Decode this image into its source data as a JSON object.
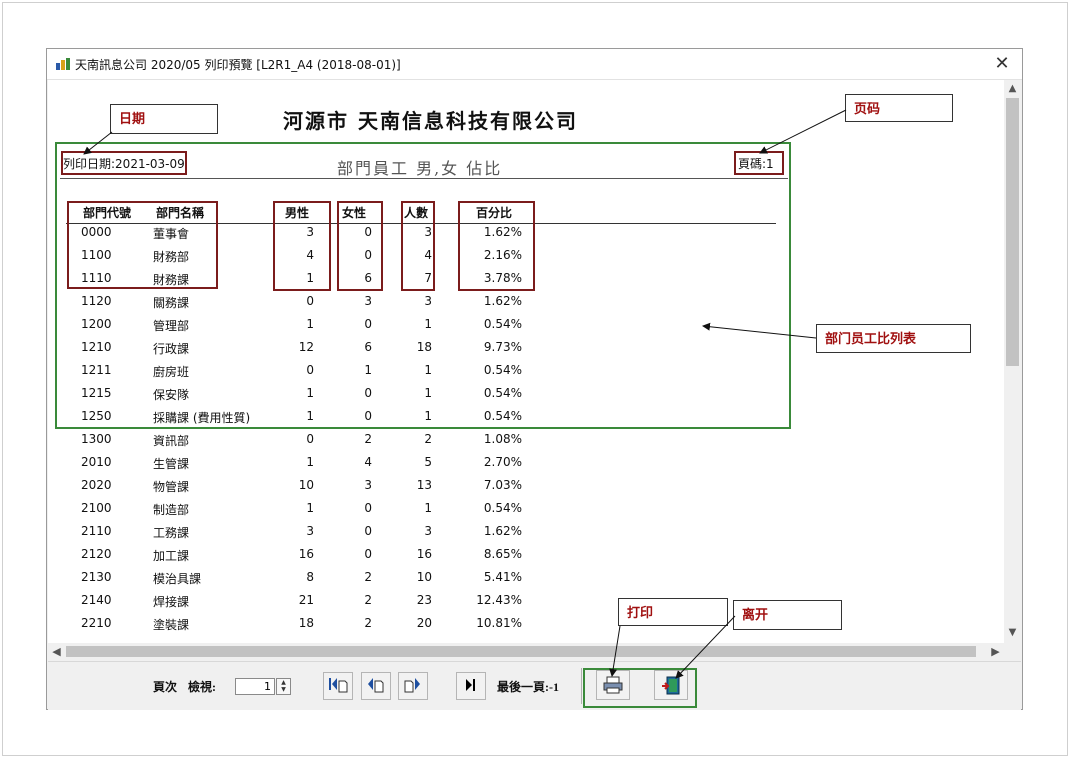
{
  "window": {
    "title": "天南訊息公司 2020/05 列印預覽 [L2R1_A4 (2018-08-01)]",
    "close_symbol": "✕"
  },
  "report": {
    "company_title": "河源市 天南信息科技有限公司",
    "subtitle": "部門員工 男,女 佔比",
    "print_date": "列印日期:2021-03-09",
    "page_no": "頁碼:1",
    "headers": {
      "code": "部門代號",
      "name": "部門名稱",
      "male": "男性",
      "female": "女性",
      "total": "人數",
      "pct": "百分比"
    },
    "rows": [
      {
        "code": "0000",
        "name": "董事會",
        "male": "3",
        "female": "0",
        "total": "3",
        "pct": "1.62%"
      },
      {
        "code": "1100",
        "name": "財務部",
        "male": "4",
        "female": "0",
        "total": "4",
        "pct": "2.16%"
      },
      {
        "code": "1110",
        "name": "財務課",
        "male": "1",
        "female": "6",
        "total": "7",
        "pct": "3.78%"
      },
      {
        "code": "1120",
        "name": "關務課",
        "male": "0",
        "female": "3",
        "total": "3",
        "pct": "1.62%"
      },
      {
        "code": "1200",
        "name": "管理部",
        "male": "1",
        "female": "0",
        "total": "1",
        "pct": "0.54%"
      },
      {
        "code": "1210",
        "name": "行政課",
        "male": "12",
        "female": "6",
        "total": "18",
        "pct": "9.73%"
      },
      {
        "code": "1211",
        "name": "廚房班",
        "male": "0",
        "female": "1",
        "total": "1",
        "pct": "0.54%"
      },
      {
        "code": "1215",
        "name": "保安隊",
        "male": "1",
        "female": "0",
        "total": "1",
        "pct": "0.54%"
      },
      {
        "code": "1250",
        "name": "採購課 (費用性質)",
        "male": "1",
        "female": "0",
        "total": "1",
        "pct": "0.54%"
      },
      {
        "code": "1300",
        "name": "資訊部",
        "male": "0",
        "female": "2",
        "total": "2",
        "pct": "1.08%"
      },
      {
        "code": "2010",
        "name": "生管課",
        "male": "1",
        "female": "4",
        "total": "5",
        "pct": "2.70%"
      },
      {
        "code": "2020",
        "name": "物管課",
        "male": "10",
        "female": "3",
        "total": "13",
        "pct": "7.03%"
      },
      {
        "code": "2100",
        "name": "制造部",
        "male": "1",
        "female": "0",
        "total": "1",
        "pct": "0.54%"
      },
      {
        "code": "2110",
        "name": "工務課",
        "male": "3",
        "female": "0",
        "total": "3",
        "pct": "1.62%"
      },
      {
        "code": "2120",
        "name": "加工課",
        "male": "16",
        "female": "0",
        "total": "16",
        "pct": "8.65%"
      },
      {
        "code": "2130",
        "name": "模治具課",
        "male": "8",
        "female": "2",
        "total": "10",
        "pct": "5.41%"
      },
      {
        "code": "2140",
        "name": "焊接課",
        "male": "21",
        "female": "2",
        "total": "23",
        "pct": "12.43%"
      },
      {
        "code": "2210",
        "name": "塗裝課",
        "male": "18",
        "female": "2",
        "total": "20",
        "pct": "10.81%"
      }
    ]
  },
  "toolbar": {
    "page_label": "頁次",
    "view_label": "檢視:",
    "page_value": "1",
    "last_page_label": "最後一頁:-1",
    "buttons": {
      "first": "first-page",
      "prev": "previous-page",
      "next": "next-page",
      "last": "last-page",
      "print": "printer-icon",
      "exit": "exit-door-icon"
    }
  },
  "annotations": {
    "date": "日期",
    "page_code": "页码",
    "table": "部门员工比列表",
    "print": "打印",
    "leave": "离开"
  },
  "colors": {
    "annotation_red": "#7b1c1c",
    "annotation_green": "#3a8a3a",
    "callout_text": "#a01010"
  }
}
